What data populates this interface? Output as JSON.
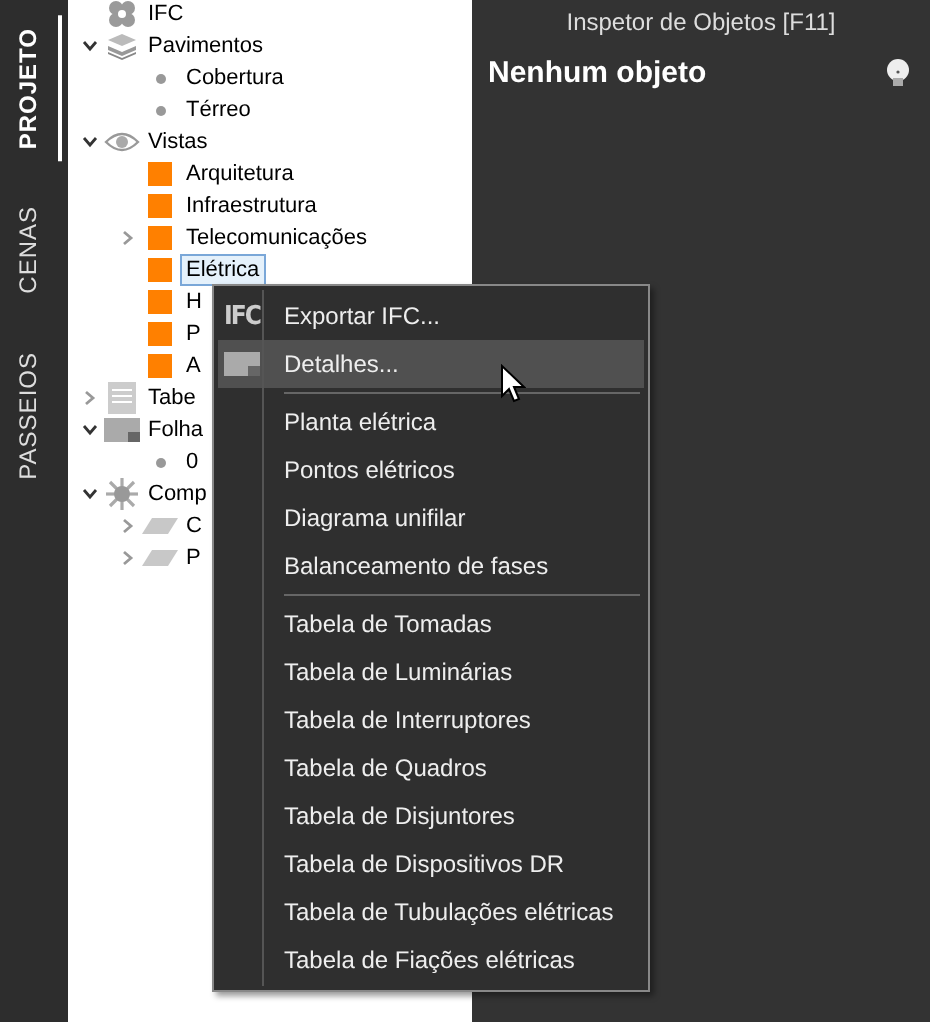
{
  "side_tabs": [
    {
      "label": "PROJETO",
      "selected": true
    },
    {
      "label": "CENAS",
      "selected": false
    },
    {
      "label": "PASSEIOS",
      "selected": false
    }
  ],
  "tree": [
    {
      "label": "IFC",
      "kind": "ifc",
      "selected": false
    },
    {
      "label": "Pavimentos",
      "kind": "layers",
      "expanded": true,
      "selected": false,
      "children": [
        {
          "label": "Cobertura",
          "kind": "dot",
          "selected": false
        },
        {
          "label": "Térreo",
          "kind": "dot",
          "selected": false
        }
      ]
    },
    {
      "label": "Vistas",
      "kind": "eye",
      "expanded": true,
      "selected": false,
      "children": [
        {
          "label": "Arquitetura",
          "kind": "square",
          "selected": false
        },
        {
          "label": "Infraestrutura",
          "kind": "square",
          "selected": false
        },
        {
          "label": "Telecomunicações",
          "kind": "square",
          "expanded": false,
          "selected": false
        },
        {
          "label": "Elétrica",
          "kind": "square",
          "selected": true
        },
        {
          "label": "H",
          "kind": "square",
          "selected": false
        },
        {
          "label": "P",
          "kind": "square",
          "selected": false
        },
        {
          "label": "A",
          "kind": "square",
          "selected": false
        }
      ]
    },
    {
      "label": "Tabe",
      "kind": "table",
      "expanded": false,
      "selected": false
    },
    {
      "label": "Folha",
      "kind": "sheet",
      "expanded": true,
      "selected": false,
      "children": [
        {
          "label": "0",
          "kind": "dot",
          "selected": false
        }
      ]
    },
    {
      "label": "Comp",
      "kind": "gear",
      "expanded": true,
      "selected": false,
      "children": [
        {
          "label": "C",
          "kind": "slab",
          "expanded": false,
          "selected": false
        },
        {
          "label": "P",
          "kind": "slab",
          "expanded": false,
          "selected": false
        }
      ]
    }
  ],
  "inspector": {
    "title": "Inspetor de Objetos [F11]",
    "heading": "Nenhum objeto"
  },
  "context_menu": [
    {
      "kind": "item",
      "label": "Exportar IFC...",
      "icon_text": "IFC",
      "highlighted": false
    },
    {
      "kind": "item",
      "label": "Detalhes...",
      "highlighted": true
    },
    {
      "kind": "separator"
    },
    {
      "kind": "item",
      "label": "Planta elétrica",
      "highlighted": false
    },
    {
      "kind": "item",
      "label": "Pontos elétricos",
      "highlighted": false
    },
    {
      "kind": "item",
      "label": "Diagrama unifilar",
      "highlighted": false
    },
    {
      "kind": "item",
      "label": "Balanceamento de fases",
      "highlighted": false
    },
    {
      "kind": "separator"
    },
    {
      "kind": "item",
      "label": "Tabela de Tomadas",
      "highlighted": false
    },
    {
      "kind": "item",
      "label": "Tabela de Luminárias",
      "highlighted": false
    },
    {
      "kind": "item",
      "label": "Tabela de Interruptores",
      "highlighted": false
    },
    {
      "kind": "item",
      "label": "Tabela de Quadros",
      "highlighted": false
    },
    {
      "kind": "item",
      "label": "Tabela de Disjuntores",
      "highlighted": false
    },
    {
      "kind": "item",
      "label": "Tabela de Dispositivos DR",
      "highlighted": false
    },
    {
      "kind": "item",
      "label": "Tabela de Tubulações elétricas",
      "highlighted": false
    },
    {
      "kind": "item",
      "label": "Tabela de Fiações elétricas",
      "highlighted": false
    }
  ]
}
